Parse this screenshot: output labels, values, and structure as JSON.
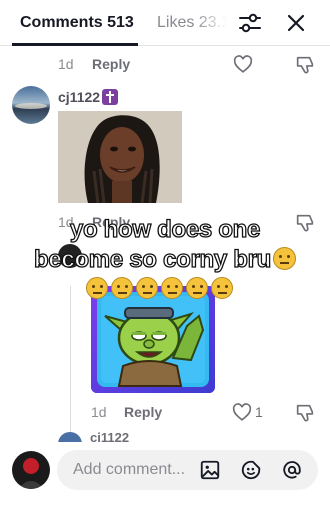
{
  "header": {
    "tabs": [
      {
        "label": "Comments 513",
        "active": true
      },
      {
        "label": "Likes 23.1",
        "active": false
      }
    ],
    "filter_icon": "sliders-icon",
    "close_icon": "close-icon"
  },
  "comment_prev": {
    "time": "1d",
    "reply_label": "Reply",
    "icons": [
      "heart-icon",
      "dislike-icon"
    ]
  },
  "comment_main": {
    "username": "cj1122",
    "badge_icon": "cross-icon",
    "image": "photo-attachment",
    "time": "1d",
    "reply_label": "Reply",
    "icons": [
      "dislike-icon"
    ]
  },
  "overlay_caption": {
    "line1": "yo how does one",
    "line2": "become so corny bru",
    "emoji_count": 7,
    "emoji_icon": "neutral-face-emoji"
  },
  "reply": {
    "sticker": "goblin-sticker",
    "time": "1d",
    "reply_label": "Reply",
    "like_count": "1",
    "icons": [
      "heart-icon",
      "dislike-icon"
    ]
  },
  "next_reply": {
    "username": "cj1122"
  },
  "composer": {
    "placeholder": "Add comment...",
    "icons": [
      "image-icon",
      "emoji-icon",
      "mention-icon"
    ]
  }
}
